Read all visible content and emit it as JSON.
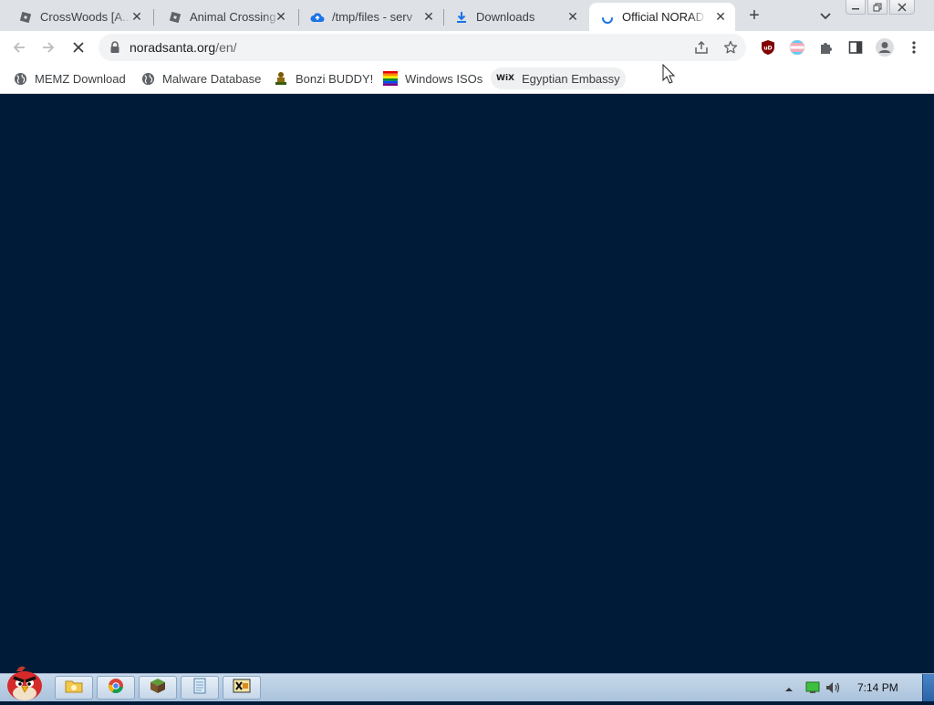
{
  "tabs": [
    {
      "title": "CrossWoods [A...",
      "icon": "roblox-icon"
    },
    {
      "title": "Animal Crossing",
      "icon": "roblox-icon"
    },
    {
      "title": "/tmp/files - serv",
      "icon": "cloud-upload-icon"
    },
    {
      "title": "Downloads",
      "icon": "download-icon"
    },
    {
      "title": "Official NORAD",
      "icon": "loading-spinner-icon",
      "active": true
    }
  ],
  "tab_close_glyph": "✕",
  "new_tab_glyph": "+",
  "address": {
    "host": "noradsanta.org",
    "path": "/en/"
  },
  "bookmarks": [
    {
      "label": "MEMZ Download",
      "icon": "globe-icon"
    },
    {
      "label": "Malware Database",
      "icon": "globe-icon"
    },
    {
      "label": "Bonzi BUDDY!",
      "icon": "bonzi-icon"
    },
    {
      "label": "Windows ISOs",
      "icon": "rainbow-flag-icon"
    },
    {
      "label": "Egyptian Embassy",
      "icon": "wix-icon"
    }
  ],
  "wix_text": "WiX",
  "ublock_text": "uD",
  "taskbar": {
    "time": "7:14 PM",
    "buttons": [
      "explorer",
      "chrome",
      "minecraft",
      "notepad",
      "xming"
    ]
  },
  "colors": {
    "page_background": "#001b38",
    "tab_strip": "#dee1e6",
    "loading_blue": "#1a73e8"
  }
}
